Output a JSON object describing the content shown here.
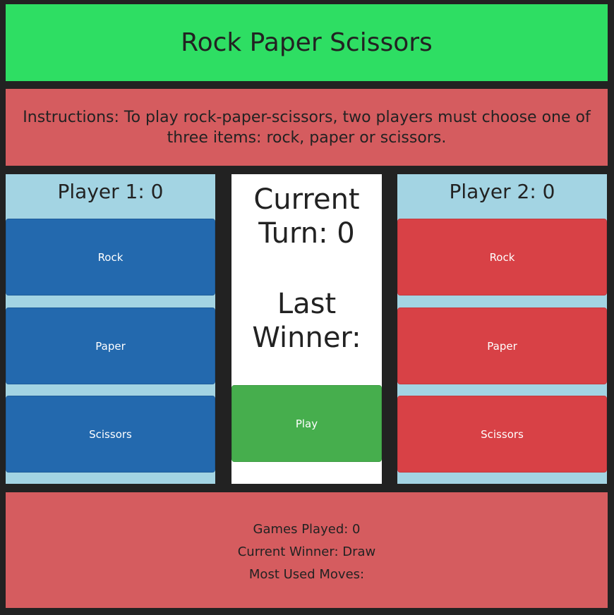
{
  "header": {
    "title": "Rock Paper Scissors"
  },
  "instructions": {
    "text": "Instructions: To play rock-paper-scissors, two players must choose one of three items: rock, paper or scissors."
  },
  "player1": {
    "title": "Player 1: 0",
    "moves": [
      "Rock",
      "Paper",
      "Scissors"
    ],
    "color": "#2369ae"
  },
  "player2": {
    "title": "Player 2: 0",
    "moves": [
      "Rock",
      "Paper",
      "Scissors"
    ],
    "color": "#d84146"
  },
  "center": {
    "current_turn": "Current Turn: 0",
    "last_winner": "Last Winner:",
    "play_label": "Play"
  },
  "stats": {
    "games_played": "Games Played: 0",
    "current_winner": "Current Winner: Draw",
    "most_used_moves": "Most Used Moves:"
  },
  "colors": {
    "header_bg": "#2ede63",
    "instructions_bg": "#d55c5f",
    "player_panel_bg": "#a3d4e3",
    "play_button": "#46ae4d",
    "page_bg": "#222222"
  }
}
